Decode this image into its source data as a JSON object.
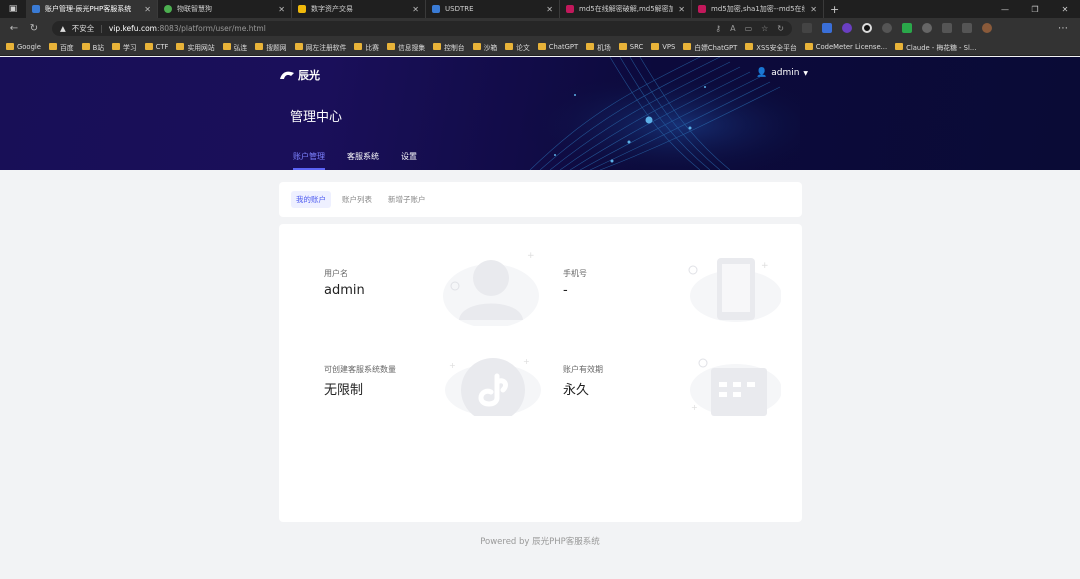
{
  "browser": {
    "tabs": [
      {
        "title": "账户管理-辰光PHP客服系统",
        "favicon_color": "#3a7bd5",
        "active": true
      },
      {
        "title": "物联智慧狗",
        "favicon_color": "#4caf50",
        "active": false
      },
      {
        "title": "数字资产交易",
        "favicon_color": "#f0b90b",
        "active": false
      },
      {
        "title": "USDTRE",
        "favicon_color": "#3a7bd5",
        "active": false
      },
      {
        "title": "md5在线解密破解,md5解密加密",
        "favicon_color": "#c2185b",
        "active": false
      },
      {
        "title": "md5加密,sha1加密--md5在线解",
        "favicon_color": "#c2185b",
        "active": false
      }
    ],
    "address": {
      "security": "不安全",
      "host": "vip.kefu.com",
      "path": ":8083/platform/user/me.html"
    },
    "bookmarks": [
      "Google",
      "百度",
      "B站",
      "学习",
      "CTF",
      "实用网站",
      "弘连",
      "搜题网",
      "网左注册软件",
      "比赛",
      "信息搜集",
      "控制台",
      "沙箱",
      "论文",
      "ChatGPT",
      "机场",
      "SRC",
      "VPS",
      "白嫖ChatGPT",
      "XSS安全平台",
      "CodeMeter License...",
      "Claude - 梅花糖 - Sl..."
    ]
  },
  "header": {
    "logo_text": "辰光",
    "user_name": "admin",
    "page_title": "管理中心",
    "tabs": [
      {
        "label": "账户管理",
        "active": true
      },
      {
        "label": "客服系统",
        "active": false
      },
      {
        "label": "设置",
        "active": false
      }
    ]
  },
  "subnav": [
    {
      "label": "我的账户",
      "active": true
    },
    {
      "label": "账户列表",
      "active": false
    },
    {
      "label": "新增子账户",
      "active": false
    }
  ],
  "stats": {
    "username": {
      "label": "用户名",
      "value": "admin"
    },
    "phone": {
      "label": "手机号",
      "value": "-"
    },
    "max_systems": {
      "label": "可创建客服系统数量",
      "value": "无限制"
    },
    "expiry": {
      "label": "账户有效期",
      "value": "永久"
    }
  },
  "footer": "Powered by 辰光PHP客服系统",
  "colors": {
    "accent": "#5b63f5",
    "hero_dark": "#0c0a3c"
  }
}
